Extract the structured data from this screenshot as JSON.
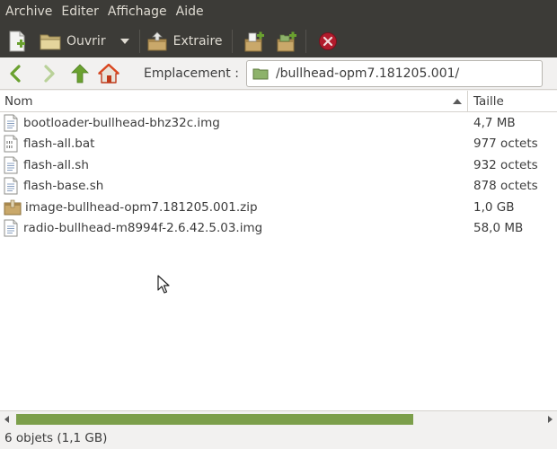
{
  "menubar": {
    "items": [
      "Archive",
      "Editer",
      "Affichage",
      "Aide"
    ]
  },
  "toolbar": {
    "open_label": "Ouvrir",
    "extract_label": "Extraire",
    "icons": [
      "new-archive-icon",
      "open-folder-icon",
      "dropdown-arrow-icon",
      "extract-icon",
      "add-files-icon",
      "add-folder-icon",
      "stop-icon"
    ]
  },
  "location": {
    "label": "Emplacement :",
    "path": "/bullhead-opm7.181205.001/"
  },
  "columns": {
    "name": "Nom",
    "size": "Taille"
  },
  "files": [
    {
      "name": "bootloader-bullhead-bhz32c.img",
      "size": "4,7 MB",
      "icon": "text-file-icon"
    },
    {
      "name": "flash-all.bat",
      "size": "977 octets",
      "icon": "binary-file-icon"
    },
    {
      "name": "flash-all.sh",
      "size": "932 octets",
      "icon": "text-file-icon"
    },
    {
      "name": "flash-base.sh",
      "size": "878 octets",
      "icon": "text-file-icon"
    },
    {
      "name": "image-bullhead-opm7.181205.001.zip",
      "size": "1,0 GB",
      "icon": "archive-file-icon"
    },
    {
      "name": "radio-bullhead-m8994f-2.6.42.5.03.img",
      "size": "58,0 MB",
      "icon": "text-file-icon"
    }
  ],
  "status": {
    "text": "6 objets (1,1 GB)"
  },
  "colors": {
    "chrome": "#3c3b37",
    "accent": "#7c9f4b",
    "folder": "#8db26a",
    "stop": "#c7162b"
  }
}
